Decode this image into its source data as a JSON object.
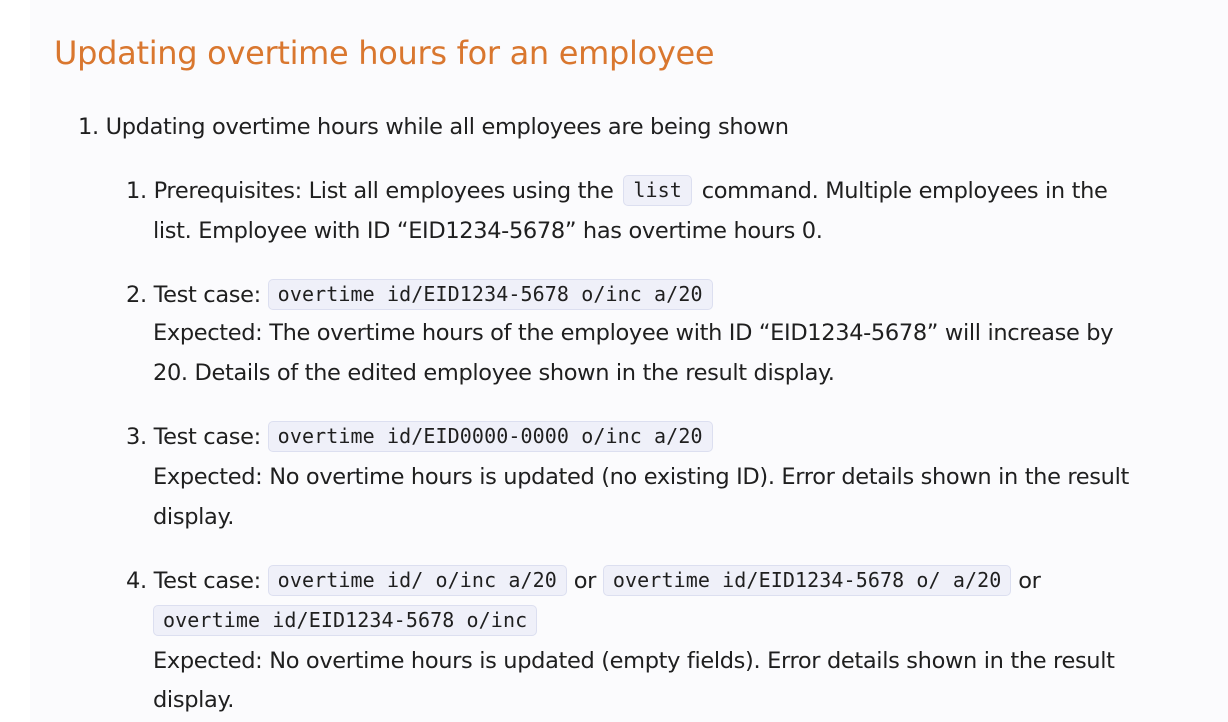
{
  "heading": "Updating overtime hours for an employee",
  "outer_item": {
    "number": "1.",
    "text": "Updating overtime hours while all employees are being shown"
  },
  "items": [
    {
      "number": "1.",
      "pre": "Prerequisites: List all employees using the",
      "code": "list",
      "post": "command. Multiple employees in the",
      "line2": "list. Employee with ID “EID1234-5678” has overtime hours 0."
    },
    {
      "number": "2.",
      "label": "Test case:",
      "code": "overtime id/EID1234-5678 o/inc a/20",
      "expected_line1": "Expected: The overtime hours of the employee with ID “EID1234-5678” will increase by",
      "expected_line2": "20. Details of the edited employee shown in the result display."
    },
    {
      "number": "3.",
      "label": "Test case:",
      "code": "overtime id/EID0000-0000 o/inc a/20",
      "expected_line1": "Expected: No overtime hours is updated (no existing ID). Error details shown in the result",
      "expected_line2": "display."
    },
    {
      "number": "4.",
      "label": "Test case:",
      "code1": "overtime id/ o/inc a/20",
      "or1": "or",
      "code2": "overtime id/EID1234-5678 o/ a/20",
      "or2": "or",
      "code3": "overtime id/EID1234-5678 o/inc",
      "expected_line1": "Expected: No overtime hours is updated (empty fields). Error details shown in the result",
      "expected_line2": "display."
    }
  ]
}
